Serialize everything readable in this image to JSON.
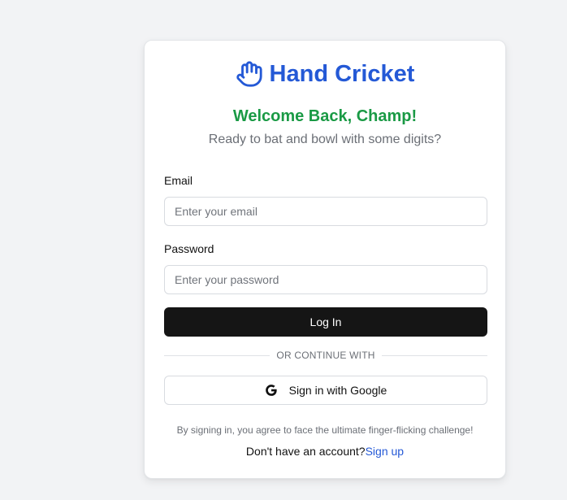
{
  "brand": {
    "title": "Hand Cricket",
    "icon": "raised-hand-icon",
    "color": "#2459d6"
  },
  "welcome": {
    "heading": "Welcome Back, Champ!",
    "heading_color": "#1a9a45",
    "subtitle": "Ready to bat and bowl with some digits?"
  },
  "form": {
    "email_label": "Email",
    "email_placeholder": "Enter your email",
    "email_value": "",
    "password_label": "Password",
    "password_placeholder": "Enter your password",
    "password_value": "",
    "login_button": "Log In"
  },
  "divider": {
    "text": "OR CONTINUE WITH"
  },
  "google": {
    "label": "Sign in with Google",
    "icon": "google-g-icon"
  },
  "footer": {
    "terms": "By signing in, you agree to face the ultimate finger-flicking challenge!",
    "no_account": "Don't have an account?",
    "signup_link": "Sign up"
  }
}
